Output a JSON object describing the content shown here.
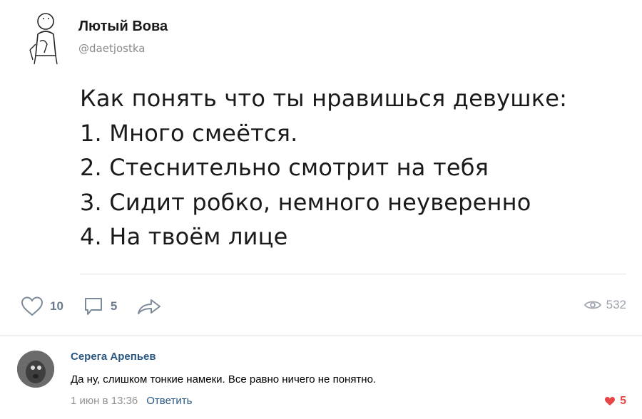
{
  "post": {
    "author_name": "Лютый Вова",
    "author_handle": "@daetjostka",
    "text_lines": [
      "Как понять что ты нравишься девушке:",
      "1. Много смеётся.",
      "2. Стеснительно смотрит на тебя",
      "3. Сидит робко, немного неуверенно",
      "4. На твоём лице"
    ],
    "likes": "10",
    "comments": "5",
    "views": "532"
  },
  "comment": {
    "author": "Серега Арепьев",
    "text": "Да ну, слишком тонкие намеки. Все равно ничего не понятно.",
    "time": "1 июн в 13:36",
    "reply_label": "Ответить",
    "likes": "5"
  },
  "colors": {
    "link": "#2a5885",
    "like_red": "#e64646",
    "icon_grey": "#7c8a99"
  },
  "icons": [
    "heart-icon",
    "comment-icon",
    "share-icon",
    "eye-icon"
  ]
}
